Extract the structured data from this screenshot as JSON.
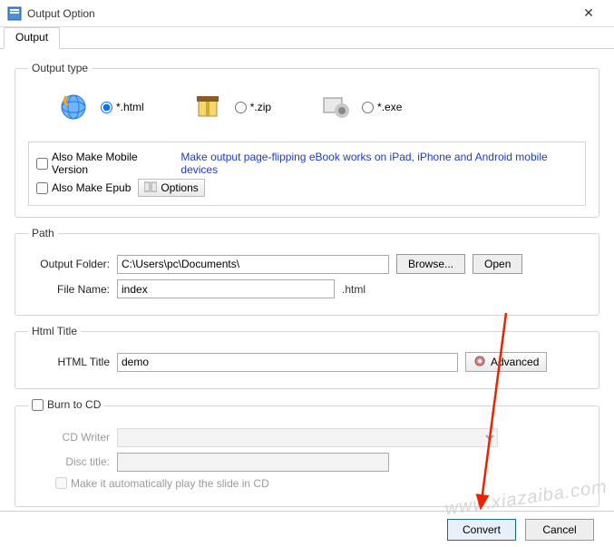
{
  "window": {
    "title": "Output Option"
  },
  "tab": {
    "label": "Output"
  },
  "outputType": {
    "legend": "Output type",
    "options": {
      "html": "*.html",
      "zip": "*.zip",
      "exe": "*.exe"
    },
    "mobile": {
      "label": "Also Make Mobile Version",
      "hint": "Make output page-flipping eBook works on iPad, iPhone and Android mobile devices"
    },
    "epub": {
      "label": "Also Make Epub"
    },
    "optionsBtn": "Options"
  },
  "path": {
    "legend": "Path",
    "folderLabel": "Output Folder:",
    "folderValue": "C:\\Users\\pc\\Documents\\",
    "browse": "Browse...",
    "open": "Open",
    "fileLabel": "File Name:",
    "fileValue": "index",
    "ext": ".html"
  },
  "htmlTitle": {
    "legend": "Html Title",
    "label": "HTML Title",
    "value": "demo",
    "advanced": "Advanced"
  },
  "cd": {
    "legend": "Burn to CD",
    "writerLabel": "CD Writer",
    "titleLabel": "Disc title:",
    "autoplay": "Make it automatically play the  slide in CD"
  },
  "footer": {
    "convert": "Convert",
    "cancel": "Cancel"
  },
  "watermark": "www.xiazaiba.com"
}
